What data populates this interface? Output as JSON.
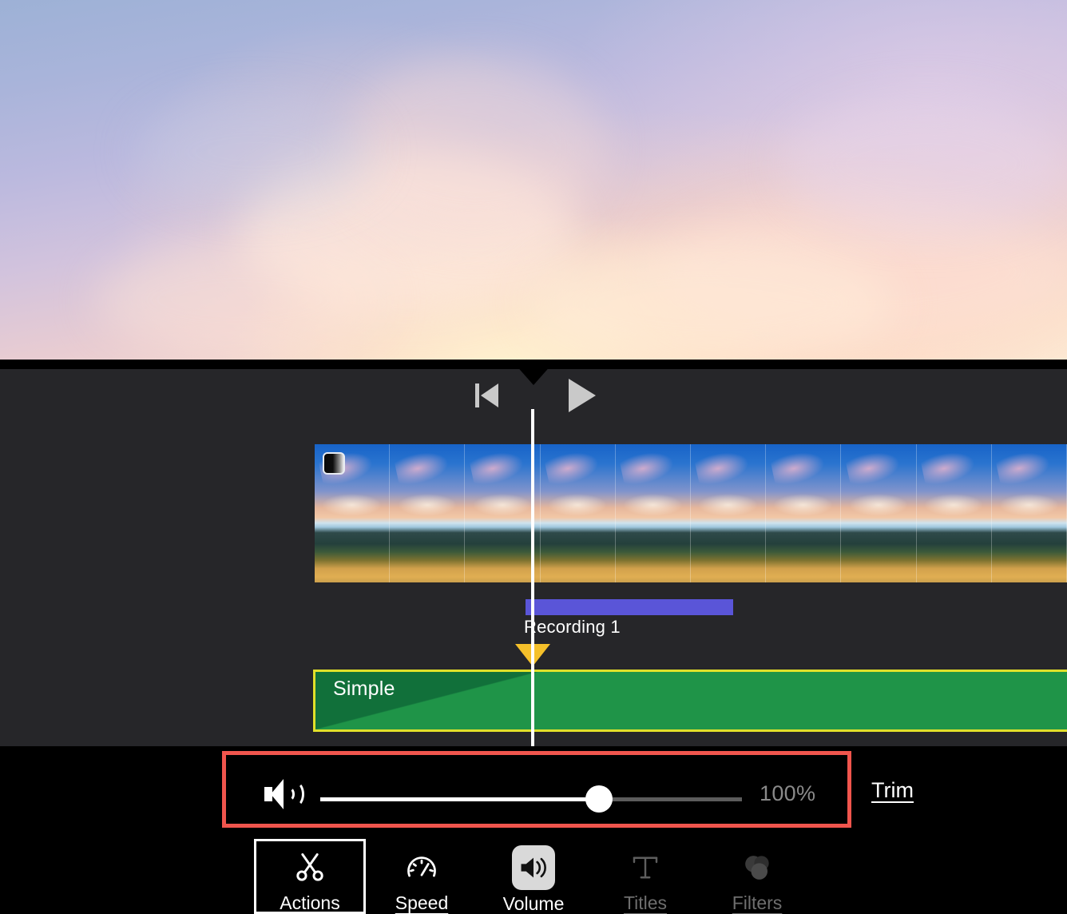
{
  "preview": {
    "name": "video-preview",
    "description": "pastel sunset sky"
  },
  "transport": {
    "skip_to_start": "skip-to-start",
    "play": "play",
    "playhead": "playhead"
  },
  "timeline": {
    "video_track": {
      "name": "video-clip",
      "frame_count": 10,
      "badge": "fade-transition-badge"
    },
    "audio_track": {
      "label": "Recording 1",
      "color": "#5a55d8"
    },
    "marker": {
      "name": "keyframe-marker",
      "color": "#f5c02a"
    },
    "title_track": {
      "label": "Simple",
      "fill_color": "#1f9448",
      "border_color": "#e0e02a"
    }
  },
  "volume": {
    "icon": "speaker-icon",
    "value": "100%",
    "slider_percent": 63,
    "highlight_color": "#f0554d",
    "trim_label": "Trim"
  },
  "toolbar": {
    "items": [
      {
        "label": "Actions",
        "icon": "scissors-icon",
        "selected": true,
        "dim": false
      },
      {
        "label": "Speed",
        "icon": "speedometer-icon",
        "selected": false,
        "dim": false
      },
      {
        "label": "Volume",
        "icon": "speaker-icon",
        "selected": false,
        "dim": false,
        "active": true
      },
      {
        "label": "Titles",
        "icon": "text-t-icon",
        "selected": false,
        "dim": true
      },
      {
        "label": "Filters",
        "icon": "circles-icon",
        "selected": false,
        "dim": true
      }
    ]
  }
}
